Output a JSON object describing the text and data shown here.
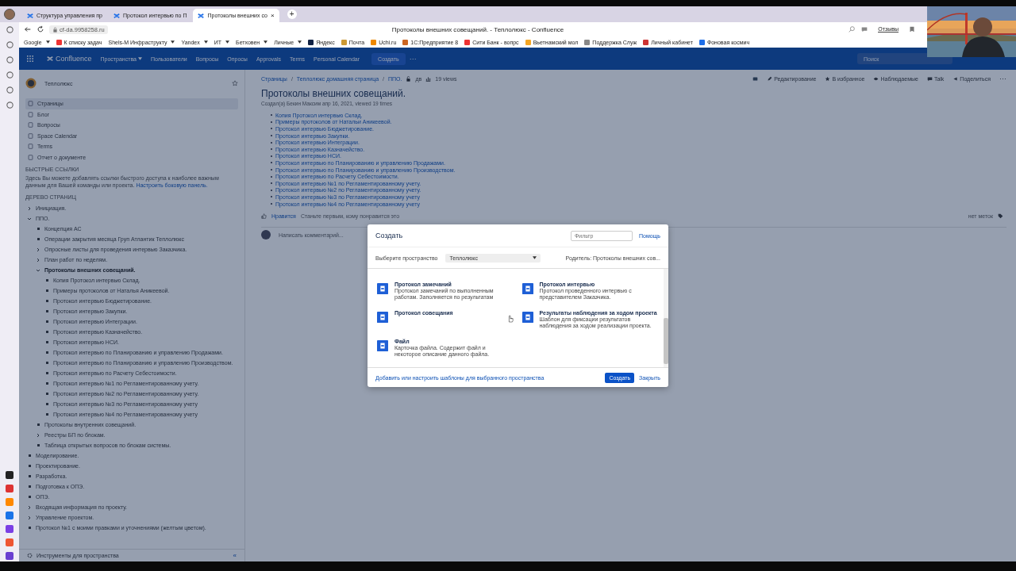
{
  "browser": {
    "tabs": [
      {
        "title": "Структура управления пр",
        "selected": false
      },
      {
        "title": "Протокол интервью по П",
        "selected": false
      },
      {
        "title": "Протоколы внешних со",
        "selected": true,
        "close": "×"
      }
    ],
    "new_tab": "+",
    "url": "cf-da.9958258.ru",
    "page_title": "Протоколы внешних совещаний. - Теплолюкс - Confluence",
    "feedback": "Отзывы",
    "bookmarks": [
      {
        "label": "Google",
        "kind": "menu"
      },
      {
        "label": "К списку задач",
        "kind": "link"
      },
      {
        "label": "Shels-M Инфраструкту",
        "kind": "menu"
      },
      {
        "label": "Yandex",
        "kind": "menu"
      },
      {
        "label": "ИТ",
        "kind": "menu"
      },
      {
        "label": "Бетховен",
        "kind": "menu"
      },
      {
        "label": "Личные",
        "kind": "menu"
      },
      {
        "label": "Яндекс",
        "kind": "link"
      },
      {
        "label": "Почта",
        "kind": "link"
      },
      {
        "label": "Uchi.ru",
        "kind": "link"
      },
      {
        "label": "1С:Предприятие 8",
        "kind": "link"
      },
      {
        "label": "Сити Банк - вопрс",
        "kind": "link"
      },
      {
        "label": "Вьетнамский мол",
        "kind": "link"
      },
      {
        "label": "Поддержка Служ",
        "kind": "link"
      },
      {
        "label": "Личный кабинет",
        "kind": "link"
      },
      {
        "label": "Фоновая космич",
        "kind": "link"
      }
    ]
  },
  "header": {
    "logo": "Confluence",
    "nav": [
      {
        "label": "Пространства",
        "kind": "menu"
      },
      {
        "label": "Пользователи",
        "kind": "link"
      },
      {
        "label": "Вопросы",
        "kind": "link"
      },
      {
        "label": "Опросы",
        "kind": "link"
      },
      {
        "label": "Approvals",
        "kind": "link"
      },
      {
        "label": "Terms",
        "kind": "link"
      },
      {
        "label": "Personal Calendar",
        "kind": "link"
      }
    ],
    "create": "Создать",
    "more": "···",
    "search": {
      "placeholder": "Поиск"
    }
  },
  "sidebar": {
    "space": "Теплолюкс",
    "nav": [
      {
        "label": "Страницы",
        "selected": true
      },
      {
        "label": "Блог",
        "selected": false
      },
      {
        "label": "Вопросы",
        "selected": false
      },
      {
        "label": "Space Calendar",
        "selected": false
      },
      {
        "label": "Terms",
        "selected": false
      },
      {
        "label": "Отчет о документе",
        "selected": false
      }
    ],
    "quick_links_heading": "БЫСТРЫЕ ССЫЛКИ",
    "quick_links_text": "Здесь Вы можете добавлять ссылки быстрого доступа к наиболее важным данным для Вашей команды или проекта.",
    "quick_links_link": "Настроить боковую панель.",
    "tree_heading": "ДЕРЕВО СТРАНИЦ",
    "tree": [
      {
        "label": "Инициация.",
        "kind": "folder",
        "expanded": false,
        "selected": false
      },
      {
        "label": "ППО.",
        "kind": "folder",
        "expanded": true,
        "selected": false,
        "children": [
          {
            "label": "Концепция АС",
            "kind": "leaf",
            "selected": false
          },
          {
            "label": "Операции закрытия месяца Груп Атлантик Теплолюкс",
            "kind": "leaf",
            "selected": false
          },
          {
            "label": "Опросные листы для проведения интервью Заказчика.",
            "kind": "folder",
            "expanded": false,
            "selected": false
          },
          {
            "label": "План работ по неделям.",
            "kind": "folder",
            "expanded": false,
            "selected": false
          },
          {
            "label": "Протоколы внешних совещаний.",
            "kind": "folder",
            "expanded": true,
            "selected": true,
            "children": [
              {
                "label": "Копия Протокол интервью Склад.",
                "kind": "leaf",
                "selected": false
              },
              {
                "label": "Примеры протоколов от Наталья Аникеевой.",
                "kind": "leaf",
                "selected": false
              },
              {
                "label": "Протокол интервью Бюджетирование.",
                "kind": "leaf",
                "selected": false
              },
              {
                "label": "Протокол интервью Закупки.",
                "kind": "leaf",
                "selected": false
              },
              {
                "label": "Протокол интервью Интеграции.",
                "kind": "leaf",
                "selected": false
              },
              {
                "label": "Протокол интервью Казначейство.",
                "kind": "leaf",
                "selected": false
              },
              {
                "label": "Протокол интервью НСИ.",
                "kind": "leaf",
                "selected": false
              },
              {
                "label": "Протокол интервью по Планированию и управлению Продажами.",
                "kind": "leaf",
                "selected": false
              },
              {
                "label": "Протокол интервью по Планированию и управлению Производством.",
                "kind": "leaf",
                "selected": false
              },
              {
                "label": "Протокол интервью по Расчету Себестоимости.",
                "kind": "leaf",
                "selected": false
              },
              {
                "label": "Протокол интервью №1 по Регламентированному учету.",
                "kind": "leaf",
                "selected": false
              },
              {
                "label": "Протокол интервью №2 по Регламентированному учету.",
                "kind": "leaf",
                "selected": false
              },
              {
                "label": "Протокол интервью №3 по Регламентированному учету",
                "kind": "leaf",
                "selected": false
              },
              {
                "label": "Протокол интервью №4 по Регламентированному учету",
                "kind": "leaf",
                "selected": false
              }
            ]
          },
          {
            "label": "Протоколы внутренних совещаний.",
            "kind": "leaf",
            "selected": false
          },
          {
            "label": "Реестры БП по блокам.",
            "kind": "folder",
            "expanded": false,
            "selected": false
          },
          {
            "label": "Таблица открытых вопросов по блокам системы.",
            "kind": "leaf",
            "selected": false
          }
        ]
      },
      {
        "label": "Моделирование.",
        "kind": "leaf",
        "selected": false
      },
      {
        "label": "Проектирование.",
        "kind": "leaf",
        "selected": false
      },
      {
        "label": "Разработка.",
        "kind": "leaf",
        "selected": false
      },
      {
        "label": "Подготовка к ОПЭ.",
        "kind": "leaf",
        "selected": false
      },
      {
        "label": "ОПЭ.",
        "kind": "leaf",
        "selected": false
      },
      {
        "label": "Входящая информация по проекту.",
        "kind": "folder",
        "expanded": false,
        "selected": false
      },
      {
        "label": "Управление проектом.",
        "kind": "folder",
        "expanded": false,
        "selected": false
      },
      {
        "label": "Протокол №1 с моими правками и уточнениями (желтым цветом).",
        "kind": "leaf",
        "selected": false
      }
    ],
    "tools": "Инструменты для пространства",
    "collapse": "«"
  },
  "page": {
    "breadcrumbs": [
      "Страницы",
      "Теплолюкс домашняя страница",
      "ППО."
    ],
    "breadcrumb_separator": "/",
    "restrictions": "дв",
    "views": "19 views",
    "actions": [
      {
        "label": "Редактирование",
        "kind": "edit"
      },
      {
        "label": "В избранное",
        "kind": "star"
      },
      {
        "label": "Наблюдаемые",
        "kind": "watch"
      },
      {
        "label": "Talk",
        "kind": "talk"
      },
      {
        "label": "Поделиться",
        "kind": "share"
      }
    ],
    "title": "Протоколы внешних совещаний.",
    "meta": "Создал(а) Бекин Максим апр 16, 2021, viewed 19 times",
    "links": [
      "Копия Протокол интервью Склад.",
      "Примеры протоколов от Натальи Аникеевой.",
      "Протокол интервью Бюджетирование.",
      "Протокол интервью Закупки.",
      "Протокол интервью Интеграции.",
      "Протокол интервью Казначейство.",
      "Протокол интервью НСИ.",
      "Протокол интервью по Планированию и управлению Продажами.",
      "Протокол интервью по Планированию и управлению Производством.",
      "Протокол интервью по Расчету Себестоимости.",
      "Протокол интервью №1 по Регламентированному учету.",
      "Протокол интервью №2 по Регламентированному учету.",
      "Протокол интервью №3 по Регламентированному учету",
      "Протокол интервью №4 по Регламентированному учету"
    ],
    "like": "Нравится",
    "like_hint": "Станьте первым, кому понравится это",
    "labels": "нет меток",
    "comment_placeholder": "Написать комментарий..."
  },
  "dialog": {
    "title": "Создать",
    "filter": {
      "placeholder": "Фильтр"
    },
    "help": "Помощь",
    "space_label": "Выберите пространство",
    "space": "Теплолюкс",
    "parent": "Родитель: Протоколы внешних сов...",
    "templates": [
      {
        "name": "Протокол замечаний",
        "description": "Протокол замечаний по выполненным работам. Заполняется по результатам"
      },
      {
        "name": "Протокол интервью",
        "description": "Протокол проведенного интервью с представителем Заказчика."
      },
      {
        "name": "Протокол совещания"
      },
      {
        "name": "Результаты наблюдения за ходом проекта",
        "description": "Шаблон для фиксации результатов наблюдения за ходом реализации проекта."
      },
      {
        "name": "Файл",
        "description": "Карточка файла. Содержит файл и некоторое описание данного файла."
      }
    ],
    "templates_link": "Добавить или настроить шаблоны для выбранного пространства",
    "create": "Создать",
    "close": "Закрыть"
  }
}
